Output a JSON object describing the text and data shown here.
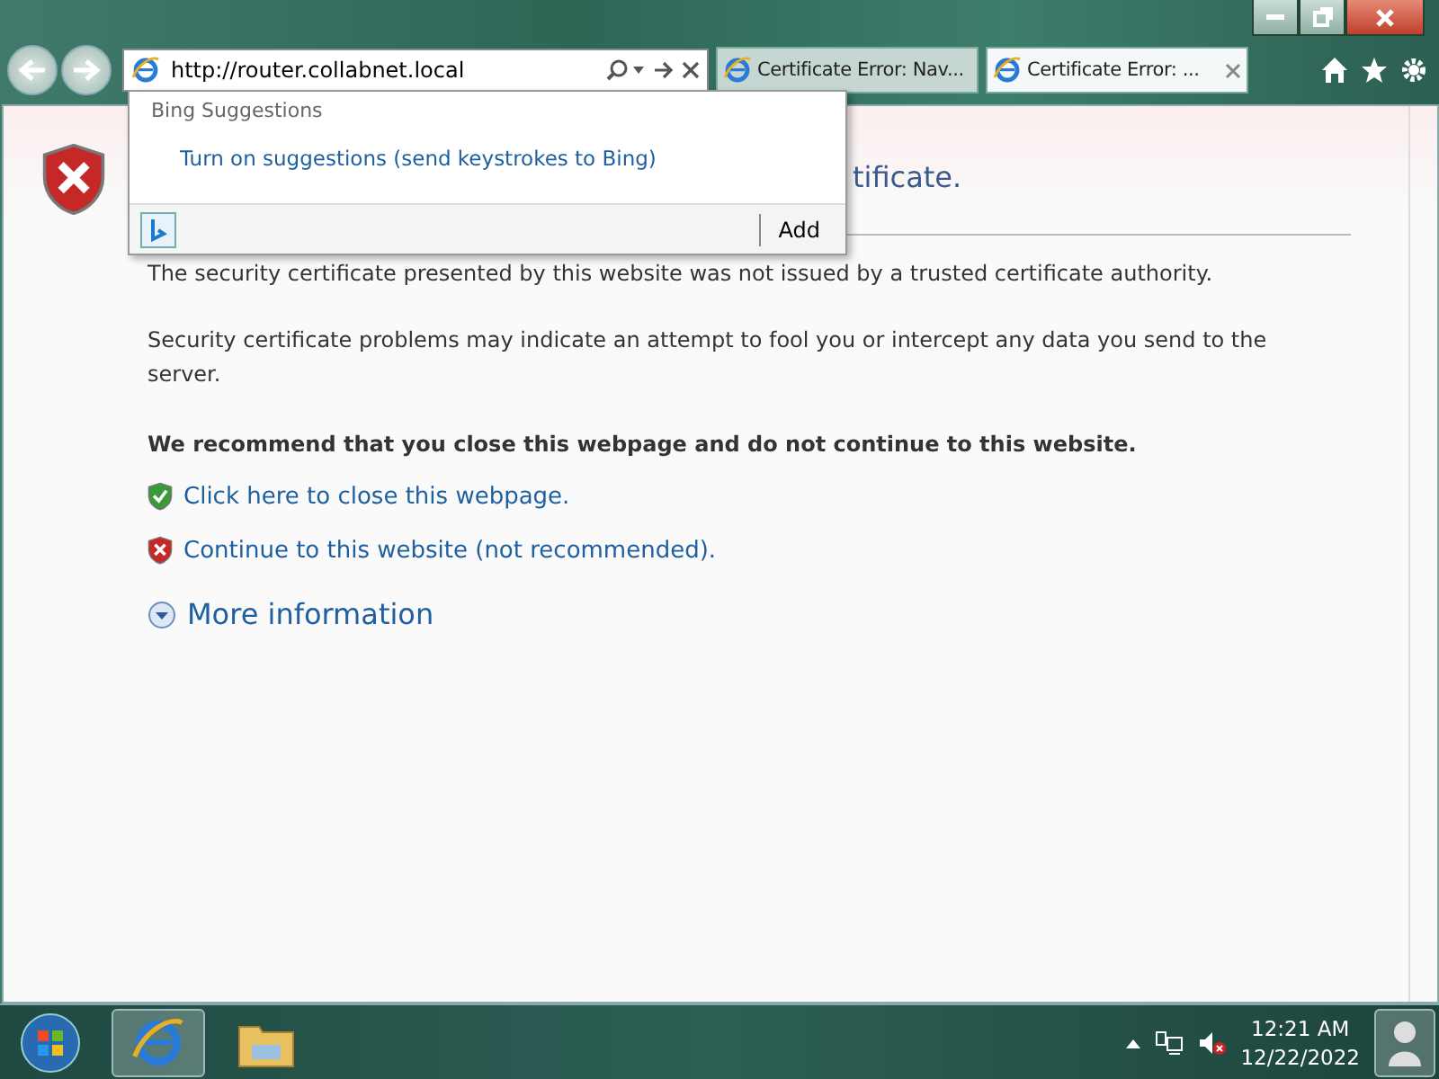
{
  "address_bar": {
    "value": "http://router.collabnet.local"
  },
  "tabs": [
    {
      "label": "Certificate Error: Nav...",
      "selected": false
    },
    {
      "label": "Certificate Error: ...",
      "selected": true
    }
  ],
  "suggestions": {
    "header": "Bing Suggestions",
    "link": "Turn on suggestions (send keystrokes to Bing)",
    "add": "Add"
  },
  "page": {
    "heading": "tificate.",
    "lines": [
      "The security certificate presented by this website was not issued by a trusted certificate authority.",
      "Security certificate problems may indicate an attempt to fool you or intercept any data you send to the server."
    ],
    "recommend": "We recommend that you close this webpage and do not continue to this website.",
    "options": [
      {
        "kind": "safe",
        "label": "Click here to close this webpage."
      },
      {
        "kind": "danger",
        "label": "Continue to this website (not recommended)."
      }
    ],
    "more": "More information"
  },
  "taskbar": {
    "time": "12:21 AM",
    "date": "12/22/2022"
  }
}
